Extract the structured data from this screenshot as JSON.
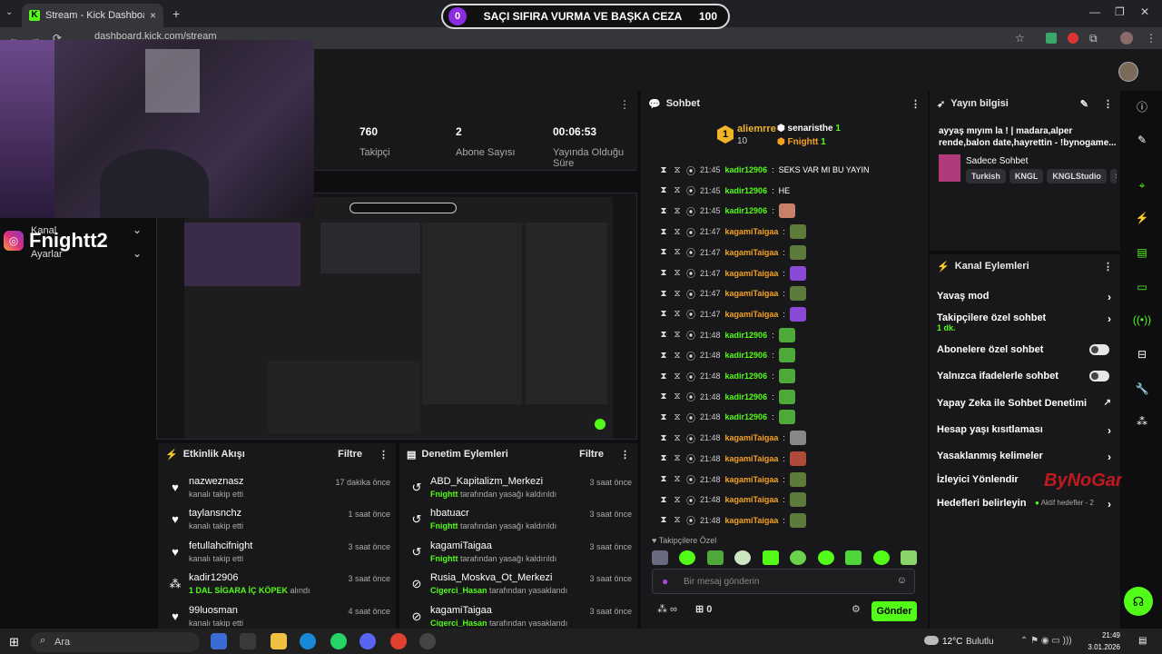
{
  "browser": {
    "tab_title": "Stream - Kick Dashboard",
    "url": "dashboard.kick.com/stream",
    "new_tab": "+",
    "close_tab": "×",
    "back": "←",
    "forward": "→",
    "reload": "⟳"
  },
  "overlay": {
    "left": "0",
    "title": "SAÇI SIFIRA VURMA VE BAŞKA CEZA",
    "right": "100"
  },
  "left_nav": {
    "instagram_name": "Fnightt2",
    "items": [
      {
        "label": "Kanal"
      },
      {
        "label": "Ayarlar"
      }
    ]
  },
  "stats": [
    {
      "value": "760",
      "label": "Takipçi"
    },
    {
      "value": "2",
      "label": "Abone Sayısı"
    },
    {
      "value": "00:06:53",
      "label": "Yayında Olduğu Süre"
    }
  ],
  "activity": {
    "title": "Etkinlik Akışı",
    "filter": "Filtre",
    "items": [
      {
        "name": "nazweznasz",
        "sub": "kanalı takip etti",
        "time": "17 dakika önce",
        "icon": "heart"
      },
      {
        "name": "taylansnchz",
        "sub": "kanalı takip etti",
        "time": "1 saat önce",
        "icon": "heart"
      },
      {
        "name": "fetullahcifnight",
        "sub": "kanalı takip etti",
        "time": "3 saat önce",
        "icon": "heart"
      },
      {
        "name": "kadir12906",
        "sub_bold": "1 DAL SİGARA İÇ KÖPEK",
        "sub": "alındı",
        "time": "3 saat önce",
        "icon": "points"
      },
      {
        "name": "99luosman",
        "sub": "kanalı takip etti",
        "time": "4 saat önce",
        "icon": "heart"
      }
    ]
  },
  "moderation": {
    "title": "Denetim Eylemleri",
    "filter": "Filtre",
    "items": [
      {
        "name": "ABD_Kapitalizm_Merkezi",
        "sub_bold": "Fnightt",
        "sub": "tarafından yasağı kaldırıldı",
        "time": "3 saat önce"
      },
      {
        "name": "hbatuacr",
        "sub_bold": "Fnightt",
        "sub": "tarafından yasağı kaldırıldı",
        "time": "3 saat önce"
      },
      {
        "name": "kagamiTaigaa",
        "sub_bold": "Fnightt",
        "sub": "tarafından yasağı kaldırıldı",
        "time": "3 saat önce"
      },
      {
        "name": "Rusia_Moskva_Ot_Merkezi",
        "sub_bold": "Cigerci_Hasan",
        "sub": "tarafından yasaklandı",
        "time": "3 saat önce"
      },
      {
        "name": "kagamiTaigaa",
        "sub_bold": "Cigerci_Hasan",
        "sub": "tarafından yasaklandı",
        "time": "3 saat önce"
      }
    ]
  },
  "chat": {
    "title": "Sohbet",
    "top_rank": "1",
    "top_user": "aliemrre",
    "top_count": "10",
    "gifters": [
      {
        "name": "senaristhe",
        "count": "1"
      },
      {
        "name": "Fnightt",
        "count": "1"
      }
    ],
    "messages": [
      {
        "time": "21:45",
        "user": "kadir12906",
        "color": "#53fc18",
        "text": "SEKS VAR MI BU YAYIN",
        "emote": ""
      },
      {
        "time": "21:45",
        "user": "kadir12906",
        "color": "#53fc18",
        "text": "HE",
        "emote": ""
      },
      {
        "time": "21:45",
        "user": "kadir12906",
        "color": "#53fc18",
        "text": "",
        "emote": "#c9806b"
      },
      {
        "time": "21:47",
        "user": "kagamiTaigaa",
        "color": "#f4a21f",
        "text": "",
        "emote": "#5c7a3a"
      },
      {
        "time": "21:47",
        "user": "kagamiTaigaa",
        "color": "#f4a21f",
        "text": "",
        "emote": "#5c7a3a"
      },
      {
        "time": "21:47",
        "user": "kagamiTaigaa",
        "color": "#f4a21f",
        "text": "",
        "emote": "#8a4ad6"
      },
      {
        "time": "21:47",
        "user": "kagamiTaigaa",
        "color": "#f4a21f",
        "text": "",
        "emote": "#5c7a3a"
      },
      {
        "time": "21:47",
        "user": "kagamiTaigaa",
        "color": "#f4a21f",
        "text": "",
        "emote": "#8a4ad6"
      },
      {
        "time": "21:48",
        "user": "kadir12906",
        "color": "#53fc18",
        "text": "",
        "emote": "#4fa83a"
      },
      {
        "time": "21:48",
        "user": "kadir12906",
        "color": "#53fc18",
        "text": "",
        "emote": "#4fa83a"
      },
      {
        "time": "21:48",
        "user": "kadir12906",
        "color": "#53fc18",
        "text": "",
        "emote": "#4fa83a"
      },
      {
        "time": "21:48",
        "user": "kadir12906",
        "color": "#53fc18",
        "text": "",
        "emote": "#4fa83a"
      },
      {
        "time": "21:48",
        "user": "kadir12906",
        "color": "#53fc18",
        "text": "",
        "emote": "#4fa83a"
      },
      {
        "time": "21:48",
        "user": "kagamiTaigaa",
        "color": "#f4a21f",
        "text": "",
        "emote": "#888888"
      },
      {
        "time": "21:48",
        "user": "kagamiTaigaa",
        "color": "#f4a21f",
        "text": "",
        "emote": "#b04a3a"
      },
      {
        "time": "21:48",
        "user": "kagamiTaigaa",
        "color": "#f4a21f",
        "text": "",
        "emote": "#5c7a3a"
      },
      {
        "time": "21:48",
        "user": "kagamiTaigaa",
        "color": "#f4a21f",
        "text": "",
        "emote": "#5c7a3a"
      },
      {
        "time": "21:48",
        "user": "kagamiTaigaa",
        "color": "#f4a21f",
        "text": "",
        "emote": "#5c7a3a"
      }
    ],
    "followers_only": "Takipçilere Özel",
    "input_placeholder": "Bir mesaj gönderin",
    "points": "0",
    "send": "Gönder"
  },
  "stream_info": {
    "title": "Yayın bilgisi",
    "stream_title": "ayyaş mıyım la ! | madara,alper rende,balon date,hayrettin - !bynogame...",
    "category": "Sadece Sohbet",
    "tags": [
      "Turkish",
      "KNGL",
      "KNGLStudio",
      "So"
    ]
  },
  "channel_actions": {
    "title": "Kanal Eylemleri",
    "items": [
      {
        "label": "Yavaş mod",
        "type": "arrow"
      },
      {
        "label": "Takipçilere özel sohbet",
        "sub": "1 dk.",
        "type": "arrow"
      },
      {
        "label": "Abonelere özel sohbet",
        "type": "toggle"
      },
      {
        "label": "Yalnızca ifadelerle sohbet",
        "type": "toggle"
      },
      {
        "label": "Yapay Zeka ile Sohbet Denetimi",
        "type": "ext"
      },
      {
        "label": "Hesap yaşı kısıtlaması",
        "type": "arrow"
      },
      {
        "label": "Yasaklanmış kelimeler",
        "type": "arrow"
      },
      {
        "label": "İzleyici Yönlendir",
        "type": "none"
      },
      {
        "label": "Hedefleri belirleyin",
        "extra": "Aktif hedefler - 2",
        "type": "arrow"
      }
    ]
  },
  "watermark": "ByNoGame",
  "taskbar": {
    "search": "Ara",
    "weather": "12°C",
    "weather_desc": "Bulutlu",
    "time": "21:49",
    "date": "3.01.2026"
  },
  "colors": {
    "kick_green": "#53fc18",
    "panel": "#18181b",
    "bg": "#0e0e10"
  }
}
